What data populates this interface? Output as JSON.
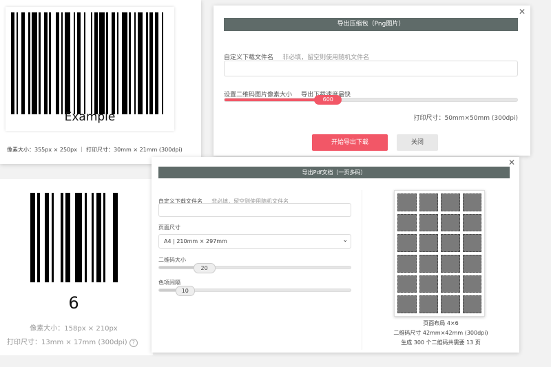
{
  "barcode_card_1": {
    "text": "Example",
    "info": "像素大小：355px × 250px ｜ 打印尺寸：30mm × 21mm (300dpi)"
  },
  "barcode_card_2": {
    "text": "6",
    "pixel_size": "像素大小：158px × 210px",
    "print_size": "打印尺寸：13mm × 17mm (300dpi)",
    "help_icon": "question-circle-icon"
  },
  "zip_dialog": {
    "header": "导出压缩包（Png图片）",
    "filename_label": "自定义下载文件名",
    "filename_hint": "非必填，留空则使用随机文件名",
    "filename_value": "",
    "size_label": "设置二维码图片像素大小",
    "size_hint": "导出下载速度最快",
    "slider_value": "600",
    "slider_fraction": 0.33,
    "print_size": "打印尺寸：50mm×50mm (300dpi)",
    "start_button": "开始导出下载",
    "close_button": "关闭",
    "close_icon": "close-icon",
    "accent_color": "#f25767"
  },
  "pdf_dialog": {
    "header": "导出Pdf文档（一页多码）",
    "filename_label": "自定义下载文件名",
    "filename_hint": "非必填，留空则使用随机文件名",
    "filename_value": "",
    "page_size_label": "页面尺寸",
    "page_size_value": "A4 | 210mm × 297mm",
    "qr_size_label": "二维码大小",
    "qr_size_value": "20",
    "qr_size_fraction": 0.2,
    "spacing_label": "色项间隔",
    "spacing_value": "10",
    "spacing_fraction": 0.1,
    "layout_text": "页面布局 4×6",
    "qr_dimension_text": "二维码尺寸 42mm×42mm (300dpi)",
    "summary_text": "生成 300 个二维码共需要 13 页",
    "preview_grid": {
      "cols": 4,
      "rows": 6
    },
    "close_icon": "close-icon"
  }
}
